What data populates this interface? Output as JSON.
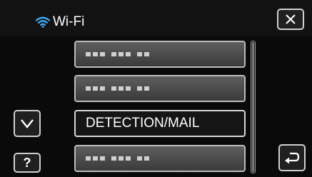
{
  "header": {
    "title": "Wi-Fi",
    "title_icon": "wifi-icon",
    "close_icon": "close-icon"
  },
  "list": {
    "items": [
      {
        "label": "",
        "obscured": true
      },
      {
        "label": "",
        "obscured": true
      },
      {
        "label": "DETECTION/MAIL",
        "obscured": false,
        "selected": true
      },
      {
        "label": "",
        "obscured": true
      }
    ]
  },
  "controls": {
    "down_icon": "chevron-down-icon",
    "help_label": "?",
    "back_icon": "return-icon"
  },
  "colors": {
    "wifi_icon": "#3fa9f5",
    "background": "#0a0a0a",
    "item_fill": "#4a4a4a"
  }
}
